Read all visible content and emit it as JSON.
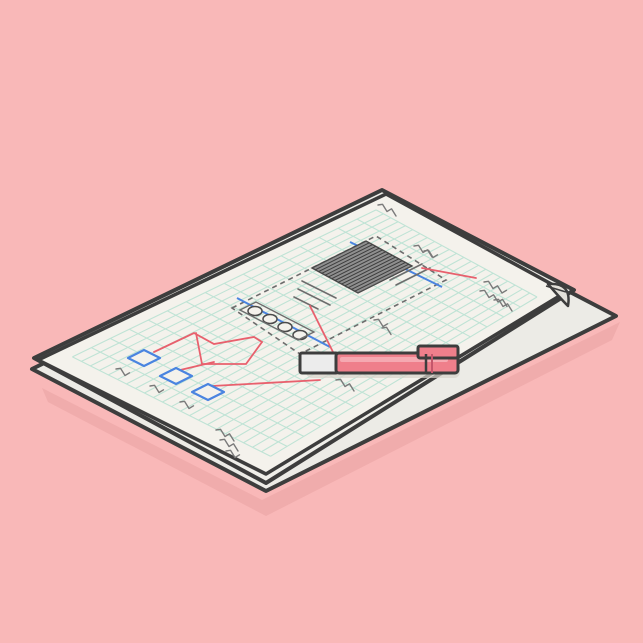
{
  "colors": {
    "background": "#f9b8b8",
    "paper": "#f4f2ec",
    "paper_under": "#ecebe6",
    "outline": "#3d3d3d",
    "grid": "#bfe3d5",
    "wireframe_blue": "#4a84e0",
    "connector_red": "#e8606d",
    "marker_body": "#ef7f8b",
    "marker_cap": "#e6e6e6",
    "scribble": "#7a7a7a",
    "shadow": "#e9a3a3"
  },
  "icons": {
    "paper_stack": "paper-stack-icon",
    "marker": "highlighter-marker-icon",
    "wireframe": "wireframe-sketch-icon",
    "flowchart": "flowchart-boxes-icon"
  }
}
